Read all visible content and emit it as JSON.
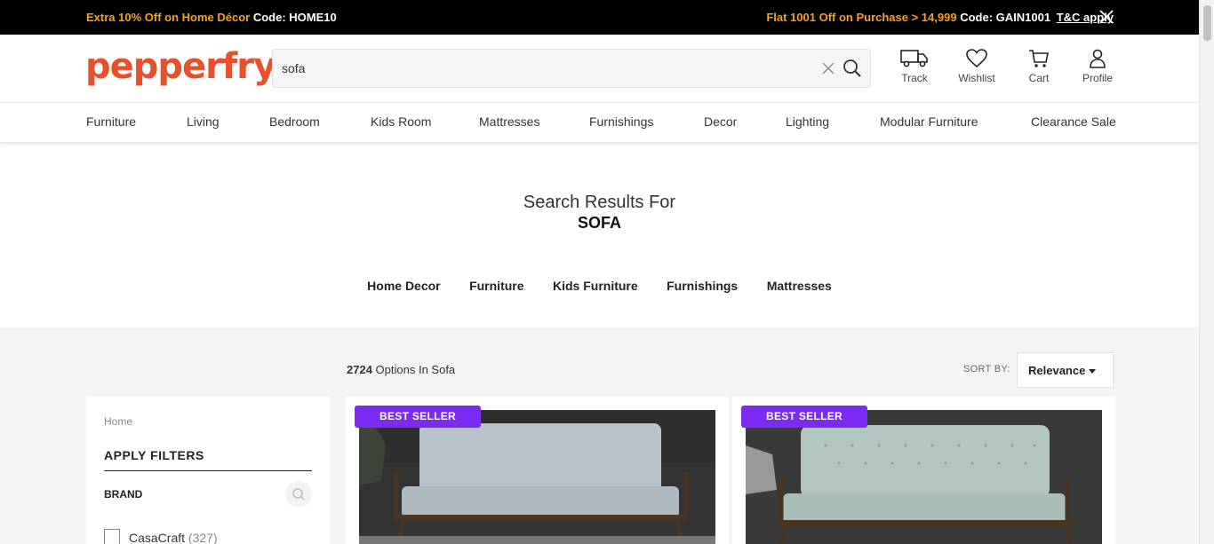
{
  "promo": {
    "left_highlight": "Extra 10% Off on Home Décor",
    "left_code": "Code: HOME10",
    "right_highlight": "Flat 1001 Off on Purchase > 14,999",
    "right_code": "Code: GAIN1001",
    "tc_link": "T&C apply"
  },
  "header": {
    "logo": "pepperfry",
    "search_value": "sofa",
    "icons": [
      {
        "label": "Track",
        "icon": "truck-icon"
      },
      {
        "label": "Wishlist",
        "icon": "heart-icon"
      },
      {
        "label": "Cart",
        "icon": "cart-icon"
      },
      {
        "label": "Profile",
        "icon": "user-icon"
      }
    ]
  },
  "nav": {
    "items": [
      "Furniture",
      "Living",
      "Bedroom",
      "Kids Room",
      "Mattresses",
      "Furnishings",
      "Decor",
      "Lighting",
      "Modular Furniture",
      "Clearance Sale"
    ]
  },
  "results": {
    "title": "Search Results For",
    "query": "SOFA",
    "categories": [
      "Home Decor",
      "Furniture",
      "Kids Furniture",
      "Furnishings",
      "Mattresses"
    ],
    "count": "2724",
    "count_label": "Options In Sofa",
    "sort_label": "SORT BY:",
    "sort_value": "Relevance"
  },
  "filters": {
    "breadcrumb": "Home",
    "title": "APPLY FILTERS",
    "brand_label": "BRAND",
    "options": [
      {
        "name": "CasaCraft",
        "count": "(327)"
      }
    ]
  },
  "products": [
    {
      "badge": "BEST SELLER",
      "color": "#b9c3cc"
    },
    {
      "badge": "BEST SELLER",
      "color": "#b3c6c2"
    }
  ],
  "colors": {
    "brand_orange": "#e6502a",
    "promo_orange": "#f7a11a",
    "badge_purple": "#7b2cf0"
  }
}
